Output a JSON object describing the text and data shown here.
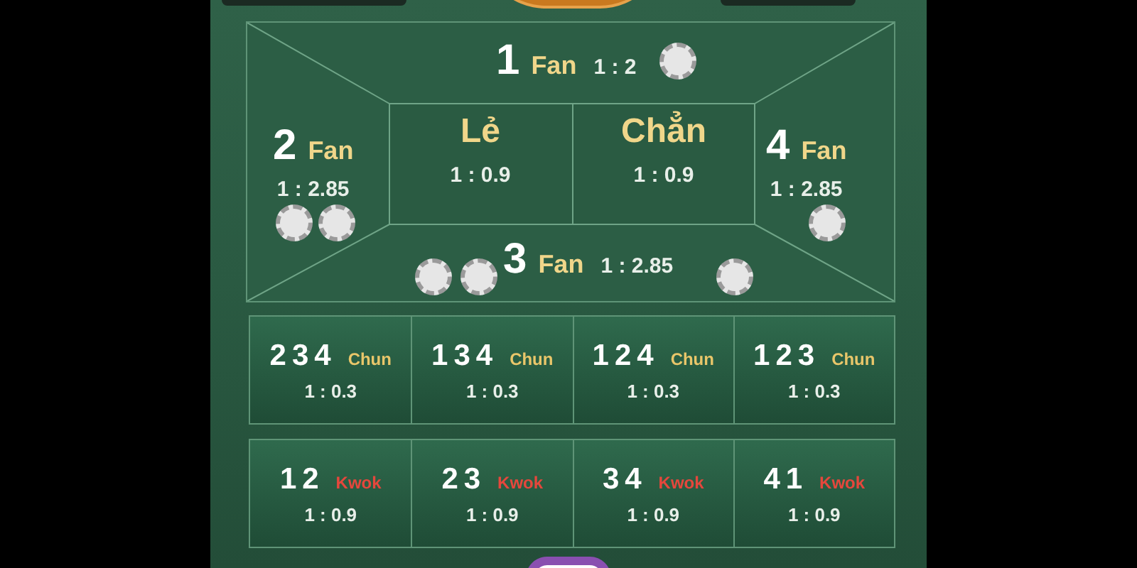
{
  "board": {
    "sides": [
      {
        "number": "1",
        "label": "Fan",
        "odds": "1 : 2"
      },
      {
        "number": "2",
        "label": "Fan",
        "odds": "1 : 2.85"
      },
      {
        "number": "3",
        "label": "Fan",
        "odds": "1 : 2.85"
      },
      {
        "number": "4",
        "label": "Fan",
        "odds": "1 : 2.85"
      }
    ],
    "center": [
      {
        "label": "Lẻ",
        "odds": "1 : 0.9"
      },
      {
        "label": "Chẳn",
        "odds": "1 : 0.9"
      }
    ]
  },
  "bet_rows": [
    {
      "kind": "chun",
      "cells": [
        {
          "numbers": "234",
          "label": "Chun",
          "odds": "1 : 0.3"
        },
        {
          "numbers": "134",
          "label": "Chun",
          "odds": "1 : 0.3"
        },
        {
          "numbers": "124",
          "label": "Chun",
          "odds": "1 : 0.3"
        },
        {
          "numbers": "123",
          "label": "Chun",
          "odds": "1 : 0.3"
        }
      ]
    },
    {
      "kind": "kwok",
      "cells": [
        {
          "numbers": "12",
          "label": "Kwok",
          "odds": "1 : 0.9"
        },
        {
          "numbers": "23",
          "label": "Kwok",
          "odds": "1 : 0.9"
        },
        {
          "numbers": "34",
          "label": "Kwok",
          "odds": "1 : 0.9"
        },
        {
          "numbers": "41",
          "label": "Kwok",
          "odds": "1 : 0.9"
        }
      ]
    }
  ]
}
